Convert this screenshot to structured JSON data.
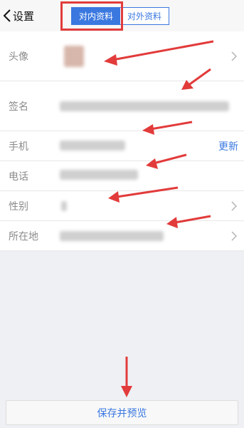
{
  "header": {
    "back_label": "设置",
    "tabs": [
      {
        "label": "对内资料",
        "active": true
      },
      {
        "label": "对外资料",
        "active": false
      }
    ]
  },
  "fields": {
    "avatar": {
      "label": "头像"
    },
    "signature": {
      "label": "签名"
    },
    "mobile": {
      "label": "手机",
      "action": "更新"
    },
    "phone": {
      "label": "电话"
    },
    "gender": {
      "label": "性别"
    },
    "location": {
      "label": "所在地"
    }
  },
  "footer": {
    "save_label": "保存并预览"
  },
  "colors": {
    "accent": "#3a78e0",
    "annotation": "#e23b3b"
  }
}
